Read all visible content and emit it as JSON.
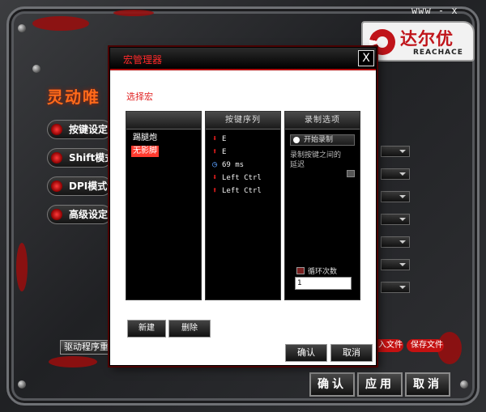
{
  "window": {
    "controls": "www  -  x"
  },
  "logo": {
    "name": "达尔优",
    "sub": "REACHACE",
    "slogan": ""
  },
  "app": {
    "title": "灵动唯"
  },
  "sidebar": {
    "tabs": [
      {
        "label": "按键设定"
      },
      {
        "label": "Shift模式设定"
      },
      {
        "label": "DPI模式设定"
      },
      {
        "label": "高级设定"
      }
    ],
    "driver_button": "驱动程序重置"
  },
  "bottom": {
    "red_pills": [
      {
        "label": "导入文件"
      },
      {
        "label": "保存文件"
      }
    ],
    "confirm": "确认",
    "apply": "应用",
    "cancel": "取消"
  },
  "dialog": {
    "title": "宏管理器",
    "close": "X",
    "select_label": "选择宏",
    "macro_column": {
      "header": "",
      "items": [
        {
          "label": "踢腿炮"
        },
        {
          "label": "无影脚"
        }
      ],
      "selected_index": 1
    },
    "sequence_column": {
      "header": "按键序列",
      "items": [
        {
          "icon": "key-down-icon",
          "text": "E"
        },
        {
          "icon": "key-up-icon",
          "text": "E"
        },
        {
          "icon": "delay-icon",
          "text": "69 ms"
        },
        {
          "icon": "key-down-icon",
          "text": "Left Ctrl"
        },
        {
          "icon": "key-up-icon",
          "text": "Left Ctrl"
        }
      ]
    },
    "options_column": {
      "header": "录制选项",
      "start_record": "开始录制",
      "record_delay": "录制按键之间的延迟",
      "loop_label": "循环次数",
      "loop_value": "1"
    },
    "new_button": "新建",
    "delete_button": "删除",
    "ok_button": "确认",
    "cancel_button": "取消"
  }
}
